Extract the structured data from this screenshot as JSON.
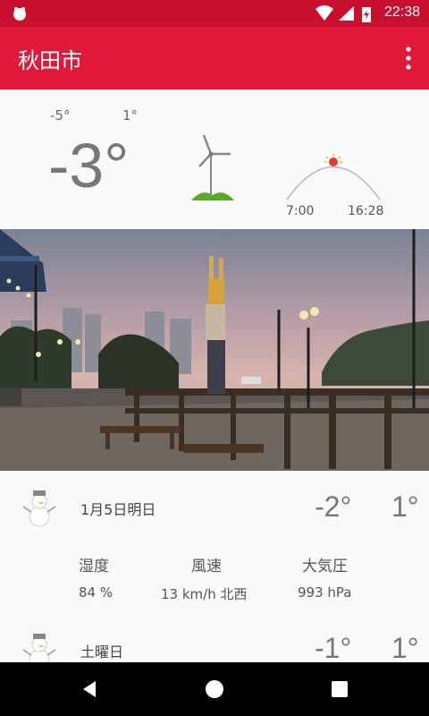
{
  "status_bar": {
    "time": "22:38"
  },
  "app_bar": {
    "title": "秋田市"
  },
  "current": {
    "low": "-5°",
    "high": "1°",
    "temp": "-3°",
    "sunrise": "7:00",
    "sunset": "16:28"
  },
  "forecast": [
    {
      "label": "1月5日明日",
      "low": "-2°",
      "high": "1°",
      "icon": "snowman-icon"
    },
    {
      "label": "土曜日",
      "low": "-1°",
      "high": "1°",
      "icon": "snowman-icon"
    }
  ],
  "details": {
    "humidity_label": "湿度",
    "humidity_value": "84 %",
    "wind_label": "風速",
    "wind_value": "13 km/h 北西",
    "pressure_label": "大気圧",
    "pressure_value": "993 hPa"
  },
  "colors": {
    "primary": "#e0193a",
    "status_bar": "#c8102e"
  }
}
